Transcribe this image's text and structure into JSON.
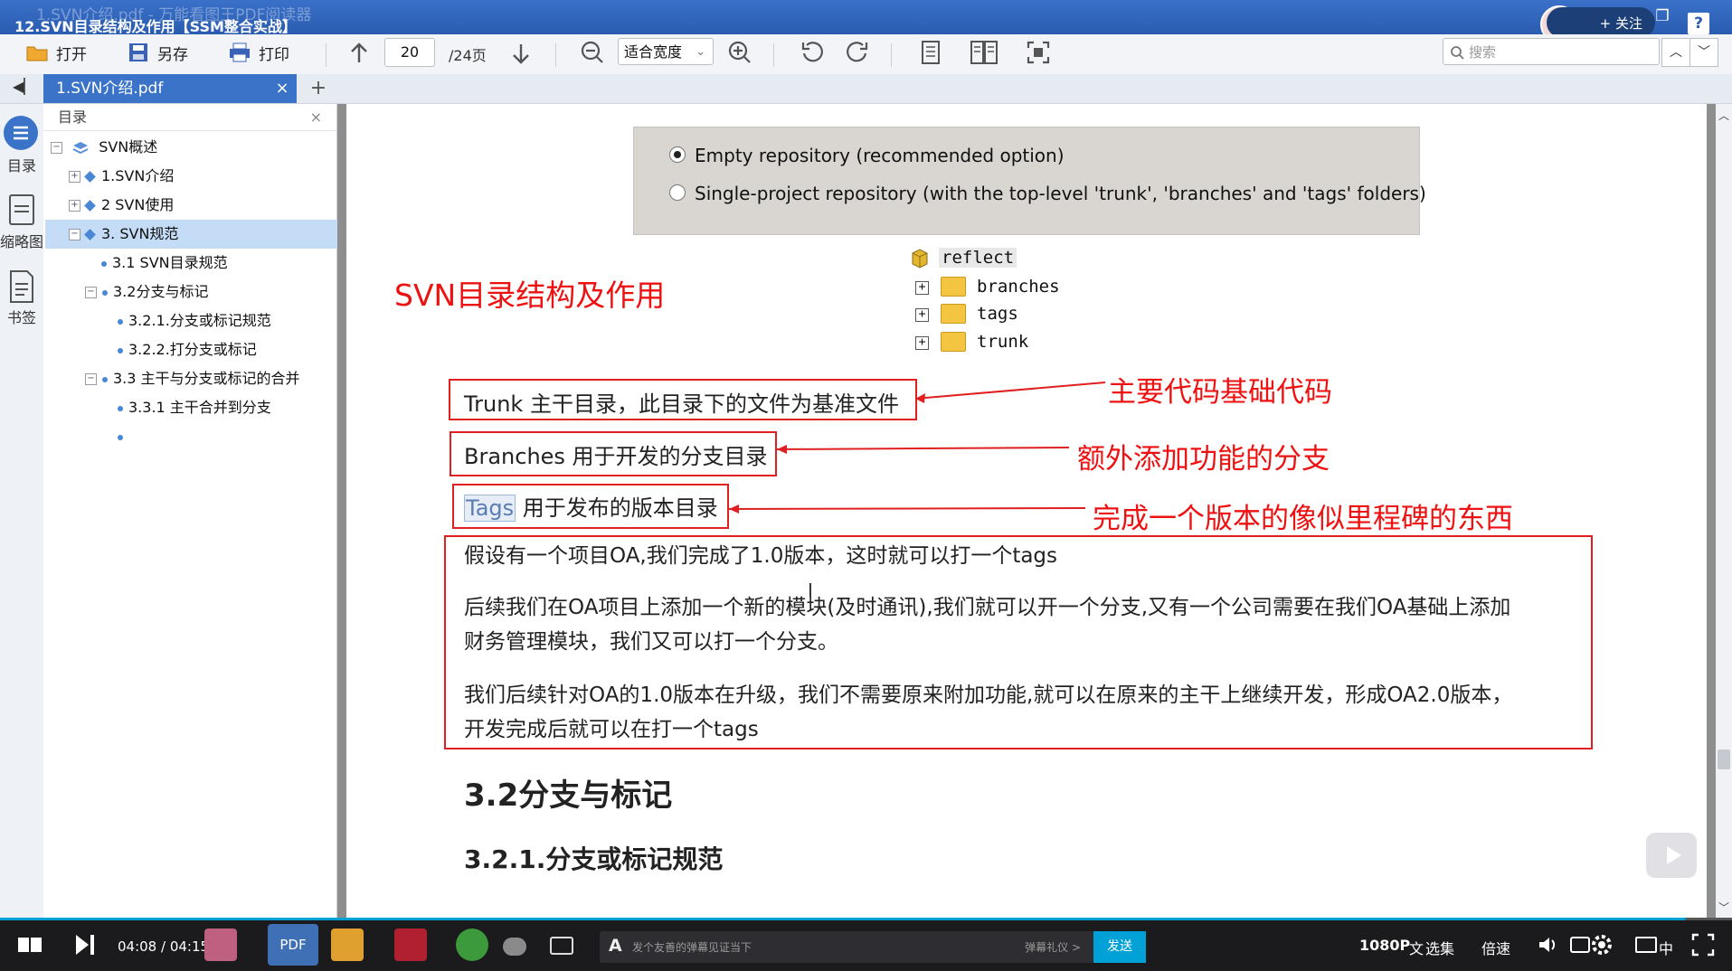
{
  "window": {
    "title_ghost": "1.SVN介绍.pdf - 万能看图王PDF阅读器",
    "video_title": "12.SVN目录结构及作用【SSM整合实战】",
    "follow_label": "+ 关注",
    "help": "?"
  },
  "toolbar": {
    "open_label": "打开",
    "saveas_label": "另存",
    "print_label": "打印",
    "page_number": "20",
    "total_pages": "/24页",
    "zoom_mode": "适合宽度",
    "search_placeholder": "搜索"
  },
  "tabs": {
    "active_file": "1.SVN介绍.pdf",
    "close": "×",
    "add": "+"
  },
  "rail": {
    "toc_label": "目录",
    "thumbs_label": "缩略图",
    "bookmarks_label": "书签"
  },
  "toc": {
    "header": "目录",
    "close": "×",
    "items": [
      {
        "label": "SVN概述",
        "expander": "−"
      },
      {
        "label": "1.SVN介绍",
        "expander": "+"
      },
      {
        "label": "2 SVN使用",
        "expander": "+"
      },
      {
        "label": "3. SVN规范",
        "expander": "−"
      },
      {
        "label": "3.1 SVN目录规范"
      },
      {
        "label": "3.2分支与标记",
        "expander": "−"
      },
      {
        "label": "3.2.1.分支或标记规范"
      },
      {
        "label": "3.2.2.打分支或标记"
      },
      {
        "label": "3.3 主干与分支或标记的合并",
        "expander": "−"
      },
      {
        "label": "3.3.1 主干合并到分支"
      },
      {
        "label": ""
      }
    ]
  },
  "document": {
    "radio_options": [
      {
        "label": "Empty repository (recommended option)",
        "selected": true
      },
      {
        "label": "Single-project repository (with the top-level 'trunk', 'branches' and 'tags' folders)",
        "selected": false
      }
    ],
    "tree": {
      "root": "reflect",
      "folders": [
        "branches",
        "tags",
        "trunk"
      ]
    },
    "annotation_title": "SVN目录结构及作用",
    "trunk_line": "Trunk 主干目录，此目录下的文件为基准文件",
    "branches_line": "Branches 用于开发的分支目录",
    "tags_word": "Tags",
    "tags_line": "用于发布的版本目录",
    "note_trunk": "主要代码基础代码",
    "note_branches": "额外添加功能的分支",
    "note_tags": "完成一个版本的像似里程碑的东西",
    "paragraphs": [
      [
        "假设有一个项目OA,我们完成了1.0版本，这时就可以打一个tags"
      ],
      [
        "后续我们在OA项目上添加一个新的模块(及时通讯),我们就可以开一个分支,又有一个公司需要在我们OA基础上添加",
        "财务管理模块，我们又可以打一个分支。"
      ],
      [
        "我们后续针对OA的1.0版本在升级，我们不需要原来附加功能,就可以在原来的主干上继续开发，形成OA2.0版本，",
        "开发完成后就可以在打一个tags"
      ]
    ],
    "heading_2": "3.2分支与标记",
    "heading_3": "3.2.1.分支或标记规范"
  },
  "player": {
    "time": "04:08 / 04:15",
    "danmu_placeholder": "发个友善的弹幕见证当下",
    "danmu_etiquette": "弹幕礼仪 >",
    "send_label": "发送",
    "quality": "1080P",
    "subtitle": "文",
    "episodes": "选集",
    "speed": "倍速",
    "subtitle_cn": "中",
    "progress_fraction": 0.973
  },
  "colors": {
    "annotation_red": "#e02020",
    "title_blue": "#2a5cb0",
    "accent_blue": "#00a1d6"
  }
}
